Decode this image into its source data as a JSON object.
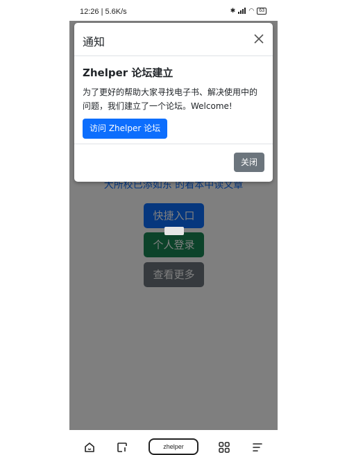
{
  "status_bar": {
    "time": "12:26 | 5.6K/s",
    "battery": "63"
  },
  "page": {
    "partial_text": "大所校已添如东 的看本中读文章",
    "buttons": [
      {
        "label": "快捷入口",
        "color": "#0d6efd"
      },
      {
        "label": "个人登录",
        "color": "#198754"
      },
      {
        "label": "查看更多",
        "color": "#6c757d"
      }
    ]
  },
  "modal": {
    "title": "通知",
    "body_title": "Zhelper 论坛建立",
    "body_text": "为了更好的帮助大家寻找电子书、解决使用中的问题，我们建立了一个论坛。Welcome!",
    "visit_button": "访问 Zhelper 论坛",
    "close_button": "关闭"
  },
  "navbar": {
    "url": "zhelper"
  }
}
